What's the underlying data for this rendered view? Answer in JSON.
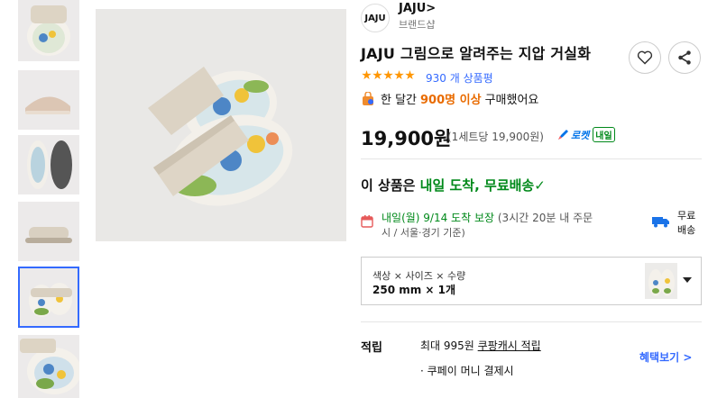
{
  "brand": {
    "logo_text": "JAJU",
    "name": "JAJU>",
    "shop_label": "브랜드샵"
  },
  "product": {
    "title": "JAJU 그림으로 알려주는 지압 거실화",
    "rating_stars": 5,
    "review_count": "930 개 상품평",
    "bought_prefix": "한 달간",
    "bought_count": "900명 이상",
    "bought_suffix": "구매했어요",
    "price": "19,900원",
    "unit_price": "(1세트당 19,900원)",
    "rocket_label": "로켓",
    "rocket_badge": "내일"
  },
  "delivery": {
    "headline_prefix": "이 상품은",
    "headline_green": "내일 도착, 무료배송✓",
    "arrival_green": "내일(월) 9/14 도착 보장",
    "arrival_gray": "(3시간 20분 내 주문",
    "arrival_line2": "시 / 서울·경기 기준)",
    "free_shipping": "무료 배송"
  },
  "option": {
    "label": "색상 × 사이즈 × 수량",
    "value": "250 mm × 1개"
  },
  "benefit": {
    "heading": "적립",
    "line1_prefix": "최대 995원",
    "line1_link": "쿠팡캐시 적립",
    "line2": "· 쿠페이 머니 결제시",
    "more": "혜택보기 >"
  },
  "icons": [
    "heart-icon",
    "share-icon",
    "shopping-bag-icon",
    "calendar-icon",
    "truck-icon",
    "rocket-icon"
  ],
  "colors": {
    "accent_blue": "#346aff",
    "green": "#00891a",
    "orange": "#e96b00",
    "star": "#ff9600"
  }
}
